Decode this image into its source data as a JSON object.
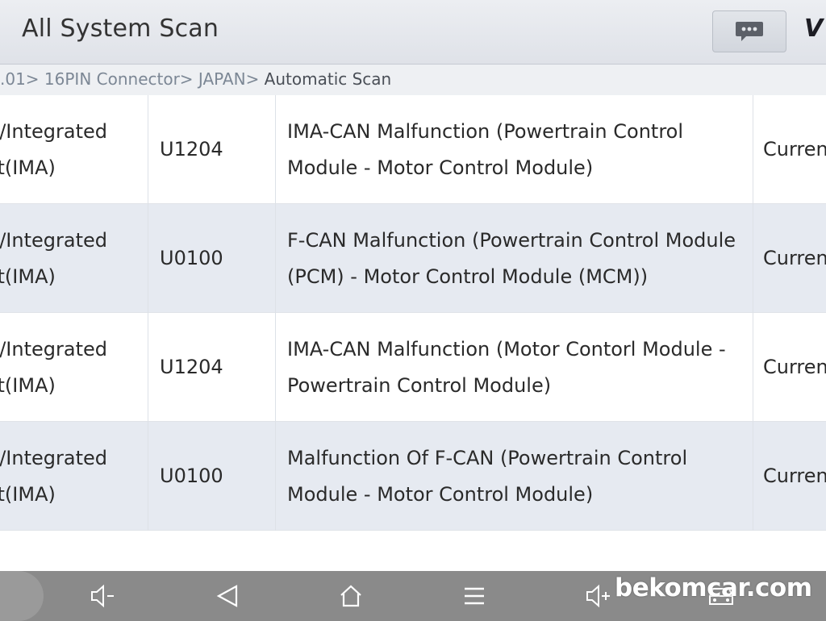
{
  "header": {
    "title": "All System Scan",
    "brand": "V"
  },
  "breadcrumb": {
    "path": ".01> 16PIN Connector> JAPAN>",
    "current": " Automatic Scan"
  },
  "dtc_rows": [
    {
      "system": "n/Integrated\nst(IMA)",
      "code": "U1204",
      "description": "IMA-CAN Malfunction (Powertrain Control Module - Motor Control Module)",
      "status": "Curren"
    },
    {
      "system": "n/Integrated\nst(IMA)",
      "code": "U0100",
      "description": "F-CAN Malfunction (Powertrain Control Module (PCM) - Motor Control Module (MCM))",
      "status": "Curren"
    },
    {
      "system": "n/Integrated\nst(IMA)",
      "code": "U1204",
      "description": "IMA-CAN Malfunction (Motor Contorl Module - Powertrain Control Module)",
      "status": "Curren"
    },
    {
      "system": "n/Integrated\nst(IMA)",
      "code": "U0100",
      "description": "Malfunction Of F-CAN (Powertrain Control Module - Motor Control Module)",
      "status": "Curren"
    }
  ],
  "navbar": {
    "icons": [
      "volume-down-icon",
      "back-icon",
      "home-icon",
      "menu-icon",
      "volume-up-icon",
      "car-icon"
    ]
  },
  "watermark": "bekomcar.com",
  "colors": {
    "row_alt": "#e6eaf1",
    "nav_bg": "#8a8a8a",
    "breadcrumb_path": "#7c8795"
  }
}
